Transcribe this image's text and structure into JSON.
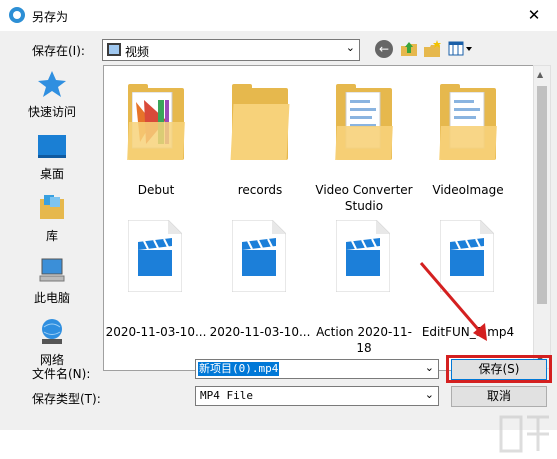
{
  "window": {
    "title": "另存为",
    "close_glyph": "✕"
  },
  "toolbar": {
    "savein_label": "保存在(I):",
    "savein_value": "视频",
    "back_icon": "back-icon",
    "up_icon": "up-folder-icon",
    "newfolder_icon": "new-folder-icon",
    "views_icon": "views-menu-icon"
  },
  "places": [
    {
      "label": "快速访问",
      "icon": "star-icon"
    },
    {
      "label": "桌面",
      "icon": "desktop-icon"
    },
    {
      "label": "库",
      "icon": "library-icon"
    },
    {
      "label": "此电脑",
      "icon": "computer-icon"
    },
    {
      "label": "网络",
      "icon": "network-icon"
    }
  ],
  "files": [
    {
      "label": "Debut",
      "kind": "folder"
    },
    {
      "label": "records",
      "kind": "folder"
    },
    {
      "label": "Video Converter Studio",
      "kind": "folder"
    },
    {
      "label": "VideoImage",
      "kind": "folder"
    },
    {
      "label": "2020-11-03-10...",
      "kind": "video"
    },
    {
      "label": "2020-11-03-10...",
      "kind": "video"
    },
    {
      "label": "Action 2020-11-18",
      "kind": "video"
    },
    {
      "label": "EditFUN_5.mp4",
      "kind": "video"
    }
  ],
  "form": {
    "filename_label": "文件名(N):",
    "filename_value": "新项目(0).mp4",
    "filetype_label": "保存类型(T):",
    "filetype_value": "MP4 File"
  },
  "buttons": {
    "save": "保存(S)",
    "cancel": "取消"
  },
  "colors": {
    "folder": "#e6b84d",
    "folder_light": "#f7d27a",
    "video_blue": "#1c7fd9",
    "highlight": "#d42020"
  }
}
